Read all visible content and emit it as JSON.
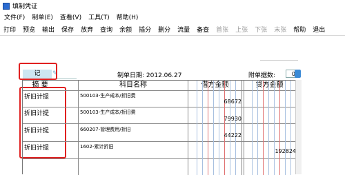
{
  "window": {
    "title": "填制凭证"
  },
  "menu": [
    "文件(F)",
    "制单(E)",
    "查看(V)",
    "工具(T)",
    "帮助(H)"
  ],
  "toolbar": [
    {
      "label": "打印",
      "enabled": true
    },
    {
      "label": "预览",
      "enabled": true
    },
    {
      "label": "输出",
      "enabled": true
    },
    {
      "label": "保存",
      "enabled": true
    },
    {
      "label": "放弃",
      "enabled": true
    },
    {
      "label": "查询",
      "enabled": true
    },
    {
      "label": "余额",
      "enabled": true
    },
    {
      "label": "插分",
      "enabled": true
    },
    {
      "label": "删分",
      "enabled": true
    },
    {
      "label": "流量",
      "enabled": true
    },
    {
      "label": "备查",
      "enabled": true
    },
    {
      "label": "首张",
      "enabled": false
    },
    {
      "label": "上张",
      "enabled": false
    },
    {
      "label": "下张",
      "enabled": false
    },
    {
      "label": "末张",
      "enabled": false
    },
    {
      "label": "帮助",
      "enabled": true
    },
    {
      "label": "退出",
      "enabled": true
    }
  ],
  "voucher": {
    "type": "记",
    "date_label": "制单日期:",
    "date": "2012.06.27",
    "attachments_label": "附单据数:",
    "attachments": "0"
  },
  "table": {
    "headers": {
      "summary": "摘 要",
      "account": "科目名称",
      "debit": "借方金额",
      "credit": "贷方金额"
    },
    "rows": [
      {
        "summary": "折旧计提",
        "account": "500103-生产成本/折旧费",
        "debit": "68672",
        "credit": ""
      },
      {
        "summary": "折旧计提",
        "account": "500103-生产成本/折旧费",
        "debit": "79930",
        "credit": ""
      },
      {
        "summary": "折旧计提",
        "account": "660207-管理费用/折旧",
        "debit": "44222",
        "credit": ""
      },
      {
        "summary": "折旧计提",
        "account": "1602-累计折旧",
        "debit": "",
        "credit": "192824"
      }
    ]
  },
  "highlight_color": "#e02020"
}
